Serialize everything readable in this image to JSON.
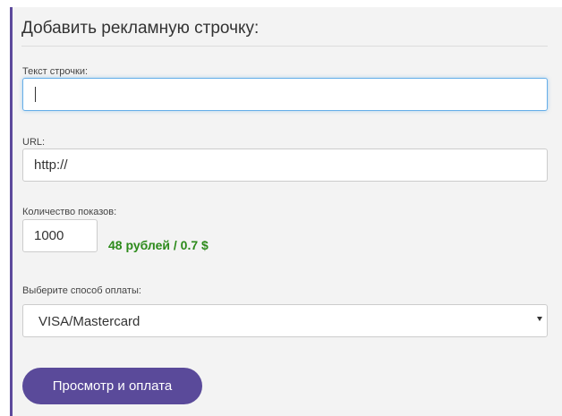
{
  "form": {
    "title": "Добавить рекламную строчку:",
    "text_label": "Текст строчки:",
    "text_value": "",
    "url_label": "URL:",
    "url_value": "http://",
    "impressions_label": "Количество показов:",
    "impressions_value": "1000",
    "price": "48 рублей / 0.7 $",
    "payment_label": "Выберите способ оплаты:",
    "payment_selected": "VISA/Mastercard",
    "submit_label": "Просмотр и оплата"
  },
  "colors": {
    "accent": "#5a4a9a",
    "price": "#2c8a1a",
    "focus": "#66afe9",
    "panel_bg": "#f3f3f3"
  },
  "icons": {
    "select_arrow": "chevron-down-icon"
  }
}
